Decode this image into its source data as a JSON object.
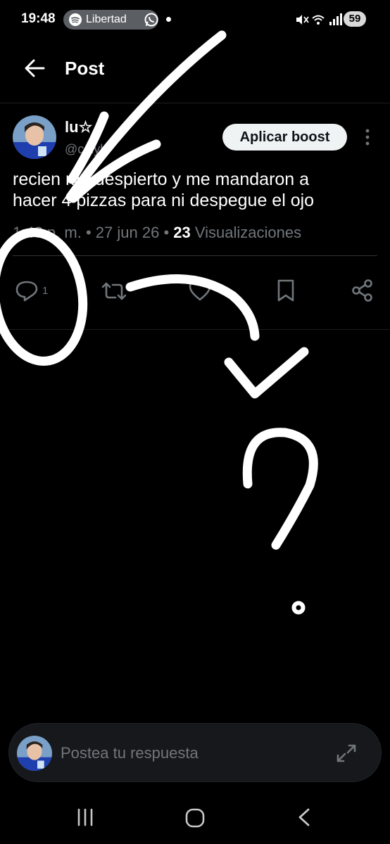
{
  "status_bar": {
    "time": "19:48",
    "spotify_label": "Libertad",
    "battery": "59"
  },
  "header": {
    "title": "Post"
  },
  "post": {
    "author_name": "lu",
    "author_star": "☆",
    "author_handle": "@cgiyb",
    "boost_label": "Aplicar boost",
    "text": "recien me despierto y me mandaron a\nhacer 4 pizzas para ni despegue el ojo",
    "time": "1:48 p. m.",
    "date": "27 jun 26",
    "views_count": "23",
    "views_label": "Visualizaciones"
  },
  "actions": {
    "reply_count": "1"
  },
  "reply_bar": {
    "placeholder": "Postea tu respuesta"
  },
  "colors": {
    "background": "#000000",
    "secondary_text": "#71767b",
    "boost_bg": "#eff3f4",
    "reply_bar_bg": "#16181c"
  }
}
